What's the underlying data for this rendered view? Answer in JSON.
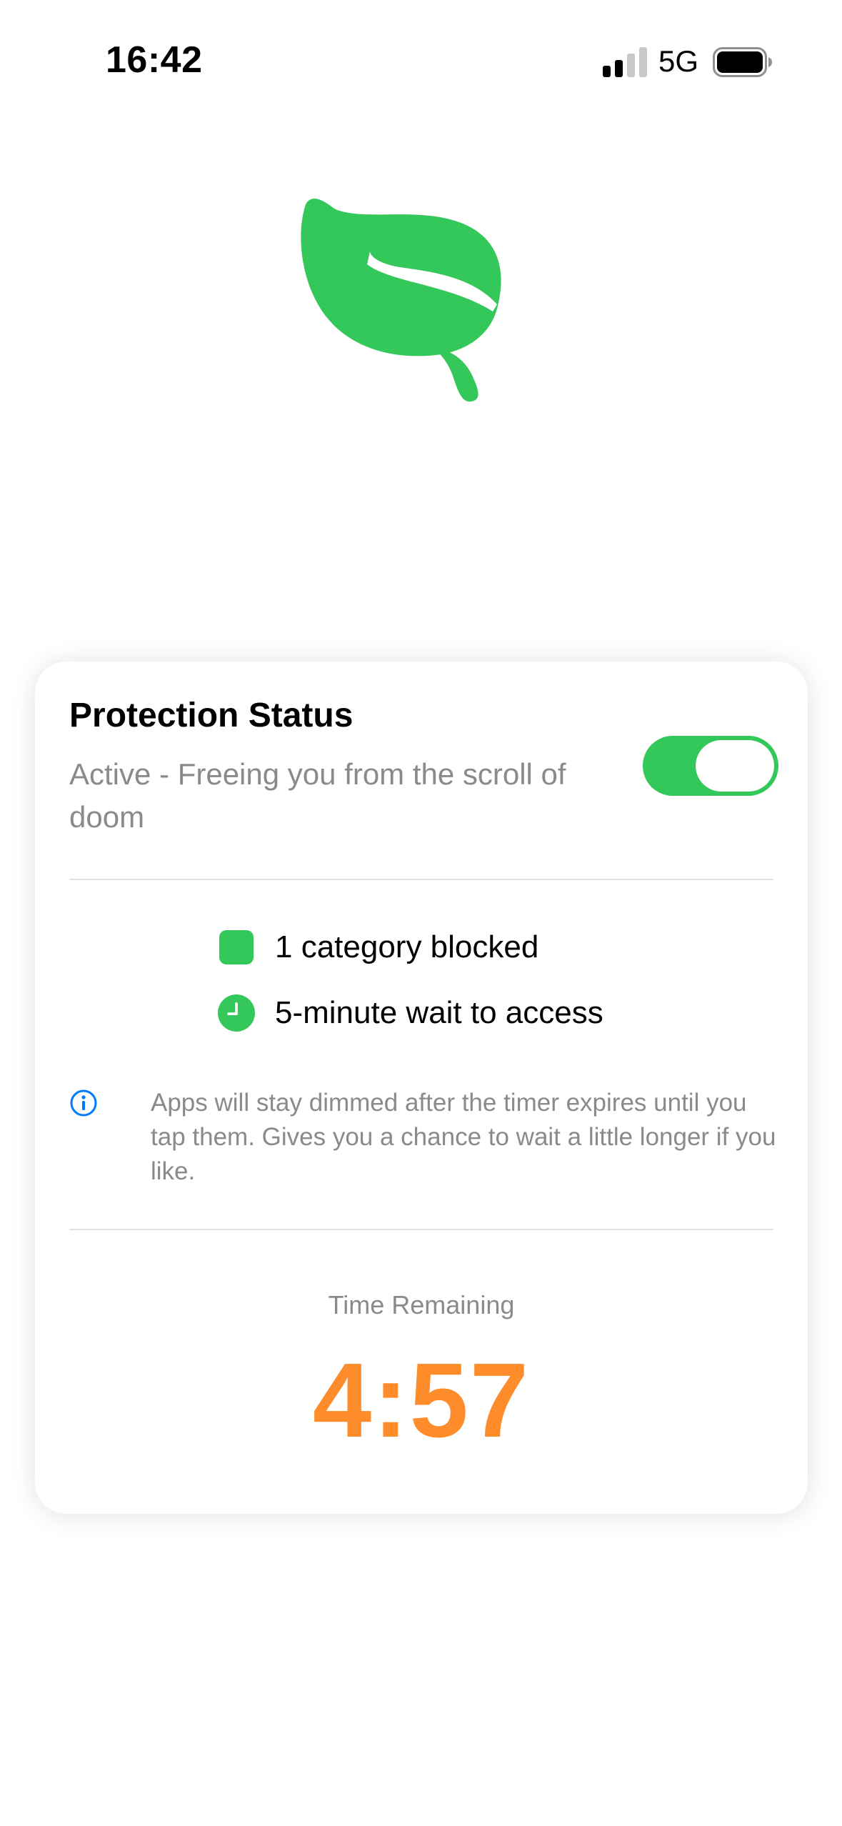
{
  "status_bar": {
    "time": "16:42",
    "network": "5G",
    "icons": [
      "signal-icon",
      "battery-icon"
    ]
  },
  "logo": {
    "icon": "leaf-icon",
    "color": "#34c759"
  },
  "protection": {
    "title": "Protection Status",
    "subtitle": "Active - Freeing you from the scroll of doom",
    "toggle_on": true
  },
  "stats": [
    {
      "icon": "category-square-icon",
      "label": "1 category blocked"
    },
    {
      "icon": "clock-icon",
      "label": "5-minute wait to access"
    }
  ],
  "info": {
    "icon": "info-icon",
    "text": "Apps will stay dimmed after the timer expires until you tap them. Gives you a chance to wait a little longer if you like."
  },
  "timer": {
    "label": "Time Remaining",
    "value": "4:57"
  },
  "colors": {
    "accent_green": "#34c759",
    "timer_orange": "#ff8c2a",
    "secondary_text": "#8a8a8e",
    "info_blue": "#007aff"
  }
}
